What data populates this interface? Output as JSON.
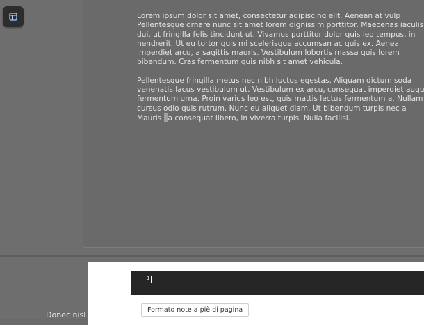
{
  "toolbar": {
    "sidebar_toggle_icon": "sidebar-panel-icon"
  },
  "document": {
    "paragraphs": [
      {
        "lines": [
          "Lorem ipsum dolor sit amet, consectetur adipiscing elit. Aenean at vulp",
          "Pellentesque ornare nunc sit amet lorem dignissim porttitor. Maecenas iaculis",
          "dui, ut fringilla felis tincidunt ut. Vivamus porttitor dolor quis leo tempus, in",
          "hendrerit. Ut eu tortor quis mi scelerisque accumsan ac quis ex. Aenea",
          "imperdiet arcu, a sagittis mauris. Vestibulum lobortis massa quis lorem",
          "bibendum. Cras fermentum quis nibh sit amet vehicula."
        ]
      },
      {
        "lines": [
          "Pellentesque fringilla metus nec nibh luctus egestas. Aliquam dictum soda",
          "venenatis lacus vestibulum ut. Vestibulum ex arcu, consequat imperdiet augue",
          "fermentum urna. Proin varius leo est, quis mattis lectus fermentum a. Nullam",
          "cursus odio quis rutrum. Nunc eu aliquet diam. Ut bibendum turpis nec a"
        ],
        "last_line_before": "Mauris ",
        "last_line_after": "a consequat libero, in viverra turpis. Nulla facilisi."
      }
    ],
    "previous_page_fragment": "Donec nisl"
  },
  "footnote": {
    "number": "1",
    "format_button_label": "Formato note a piè di pagina"
  },
  "colors": {
    "workspace": "#6e6e6e",
    "footnote_editor": "#262626",
    "text": "#e4e4e4"
  }
}
